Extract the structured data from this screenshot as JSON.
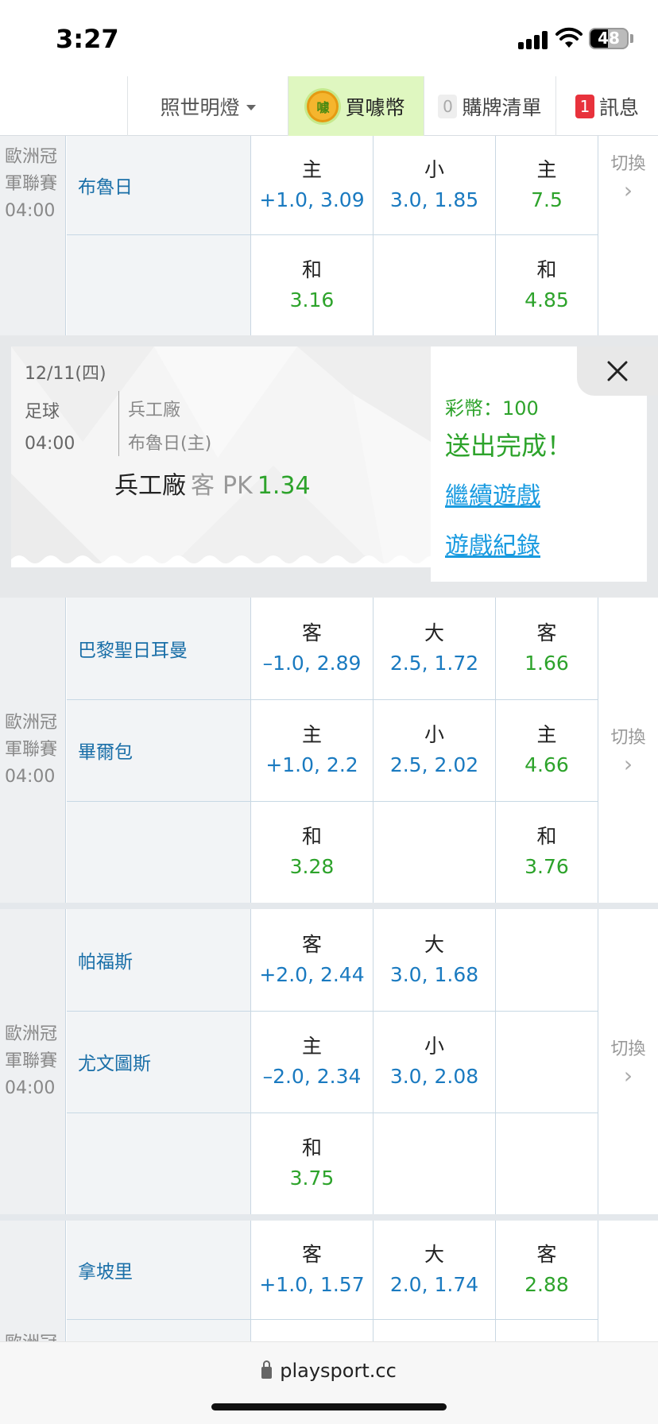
{
  "status": {
    "time": "3:27",
    "battery": "48"
  },
  "nav": {
    "lantern": "照世明燈",
    "buy_coin": "買噱幣",
    "coin_icon_text": "噱",
    "cart_count": "0",
    "cart": "購牌清單",
    "msg_count": "1",
    "msg": "訊息"
  },
  "match1": {
    "league": "歐洲冠軍聯賽",
    "league_l1": "歐洲冠",
    "league_l2": "軍聯賽",
    "time": "04:00",
    "team": "布魯日",
    "handicap": {
      "label": "主",
      "value": "+1.0, 3.09"
    },
    "total": {
      "label": "小",
      "value": "3.0, 1.85"
    },
    "moneyline": {
      "label": "主",
      "value": "7.5"
    },
    "draw_hc": {
      "label": "和",
      "value": "3.16"
    },
    "draw_ml": {
      "label": "和",
      "value": "4.85"
    },
    "switch": "切換"
  },
  "popup": {
    "date": "12/11(四)",
    "sport": "足球",
    "time": "04:00",
    "away": "兵工廠",
    "home": "布魯日(主)",
    "pick_team": "兵工廠",
    "pick_side": "客",
    "pick_type": "PK",
    "pick_odds": "1.34",
    "coins": "彩幣：100",
    "done": "送出完成！",
    "continue": "繼續遊戲",
    "history": "遊戲紀錄"
  },
  "match2": {
    "league_l1": "歐洲冠",
    "league_l2": "軍聯賽",
    "time": "04:00",
    "away_team": "巴黎聖日耳曼",
    "home_team": "畢爾包",
    "r1": {
      "hc_label": "客",
      "hc_value": "–1.0, 2.89",
      "tot_label": "大",
      "tot_value": "2.5, 1.72",
      "ml_label": "客",
      "ml_value": "1.66"
    },
    "r2": {
      "hc_label": "主",
      "hc_value": "+1.0, 2.2",
      "tot_label": "小",
      "tot_value": "2.5, 2.02",
      "ml_label": "主",
      "ml_value": "4.66"
    },
    "r3": {
      "hc_label": "和",
      "hc_value": "3.28",
      "ml_label": "和",
      "ml_value": "3.76"
    },
    "switch": "切換"
  },
  "match3": {
    "league_l1": "歐洲冠",
    "league_l2": "軍聯賽",
    "time": "04:00",
    "away_team": "帕福斯",
    "home_team": "尤文圖斯",
    "r1": {
      "hc_label": "客",
      "hc_value": "+2.0, 2.44",
      "tot_label": "大",
      "tot_value": "3.0, 1.68"
    },
    "r2": {
      "hc_label": "主",
      "hc_value": "–2.0, 2.34",
      "tot_label": "小",
      "tot_value": "3.0, 2.08"
    },
    "r3": {
      "hc_label": "和",
      "hc_value": "3.75"
    },
    "switch": "切換"
  },
  "match4": {
    "league_partial": "歐洲冠",
    "away_team": "拿坡里",
    "r1": {
      "hc_label": "客",
      "hc_value": "+1.0, 1.57",
      "tot_label": "大",
      "tot_value": "2.0, 1.74",
      "ml_label": "客",
      "ml_value": "2.88"
    }
  },
  "browser": {
    "url": "playsport.cc"
  }
}
